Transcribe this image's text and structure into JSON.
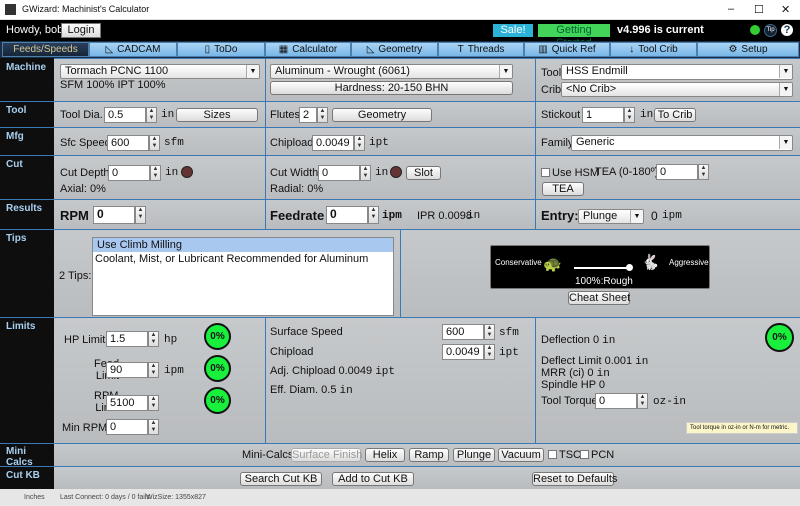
{
  "window": {
    "title": "GWizard: Machinist's Calculator",
    "minimize": "–",
    "maximize": "☐",
    "close": "✕"
  },
  "topbar": {
    "greeting": "Howdy, bob!",
    "login": "Login",
    "sale": "Sale!",
    "getting_started": "Getting Started",
    "version": "v4.996 is current",
    "tip": "Tip",
    "help": "?"
  },
  "tabs": [
    {
      "label": "Feeds/Speeds",
      "icon": ""
    },
    {
      "label": "CADCAM",
      "icon": "◺"
    },
    {
      "label": "ToDo",
      "icon": "▯"
    },
    {
      "label": "Calculator",
      "icon": "▦"
    },
    {
      "label": "Geometry",
      "icon": "◺"
    },
    {
      "label": "Threads",
      "icon": "T"
    },
    {
      "label": "Quick Ref",
      "icon": "▥"
    },
    {
      "label": "Tool Crib",
      "icon": "↓"
    },
    {
      "label": "Setup",
      "icon": "⚙"
    }
  ],
  "sections": {
    "machine": "Machine",
    "tool": "Tool",
    "mfg": "Mfg",
    "cut": "Cut",
    "results": "Results",
    "tips": "Tips",
    "limits": "Limits",
    "mini_calcs": "Mini Calcs",
    "cut_kb": "Cut KB"
  },
  "machine": {
    "machine": "Tormach PCNC 1100",
    "sfm_ipt": "SFM 100% IPT 100%",
    "material": "Aluminum - Wrought (6061)",
    "hardness": "Hardness: 20-150 BHN",
    "tool_label": "Tool",
    "tool": "HSS Endmill",
    "crib_label": "Crib",
    "crib": "<No Crib>"
  },
  "tool": {
    "dia_label": "Tool Dia.",
    "dia": "0.5",
    "dia_unit": "in",
    "sizes": "Sizes",
    "flutes_label": "Flutes",
    "flutes": "2",
    "geometry": "Geometry",
    "stickout_label": "Stickout",
    "stickout": "1",
    "stickout_unit": "in",
    "to_crib": "To Crib"
  },
  "mfg": {
    "sfc_label": "Sfc Speed",
    "sfc": "600",
    "sfc_unit": "sfm",
    "chip_label": "Chipload",
    "chip": "0.0049",
    "chip_unit": "ipt",
    "family_label": "Family:",
    "family": "Generic"
  },
  "cut": {
    "depth_label": "Cut Depth",
    "depth": "0",
    "depth_unit": "in",
    "axial": "Axial: 0%",
    "width_label": "Cut Width",
    "width": "0",
    "width_unit": "in",
    "slot": "Slot",
    "radial": "Radial: 0%",
    "hsm": "Use HSM",
    "tea_label": "TEA (0-180º)",
    "tea": "0",
    "tea_btn": "TEA"
  },
  "results": {
    "rpm_label": "RPM",
    "rpm": "0",
    "feed_label": "Feedrate",
    "feed": "0",
    "feed_unit": "ipm",
    "ipr": "IPR 0.0098",
    "ipr_unit": "in",
    "entry_label": "Entry:",
    "entry": "Plunge",
    "entry_val": "0",
    "entry_unit": "ipm"
  },
  "tips": {
    "count": "2 Tips:",
    "items": [
      "Use Climb Milling",
      "Coolant, Mist, or Lubricant Recommended for Aluminum"
    ],
    "conservative": "Conservative",
    "aggressive": "Aggressive",
    "slider_text": "100%:Rough",
    "slider_value": 1.0,
    "cheat": "Cheat Sheet"
  },
  "limits": {
    "hp_label": "HP Limit",
    "hp": "1.5",
    "hp_unit": "hp",
    "hp_pct": "0%",
    "feed_label1": "Feed",
    "feed_label2": "Limit",
    "feed": "90",
    "feed_unit": "ipm",
    "feed_pct": "0%",
    "rpm_label1": "RPM",
    "rpm_label2": "Limit",
    "rpm": "5100",
    "rpm_pct": "0%",
    "minrpm_label": "Min RPM",
    "minrpm": "0",
    "surf_label": "Surface Speed",
    "surf": "600",
    "surf_unit": "sfm",
    "chip_label": "Chipload",
    "chip": "0.0049",
    "chip_unit": "ipt",
    "adj": "Adj. Chipload 0.0049",
    "adj_unit": "ipt",
    "eff": "Eff. Diam. 0.5",
    "eff_unit": "in",
    "defl": "Deflection 0",
    "defl_unit": "in",
    "defl_pct": "0%",
    "defl_limit": "Deflect Limit 0.001",
    "defl_limit_unit": "in",
    "mrr": "MRR (ci) 0",
    "mrr_unit": "in",
    "spindle": "Spindle HP 0",
    "torque_label": "Tool Torque",
    "torque": "0",
    "torque_unit": "oz-in",
    "tooltip": "Tool torque in oz-in or N-m for metric."
  },
  "mini": {
    "label": "Mini-Calcs",
    "surface": "Surface Finish",
    "helix": "Helix",
    "ramp": "Ramp",
    "plunge": "Plunge",
    "vacuum": "Vacuum",
    "tsc": "TSC",
    "pcn": "PCN"
  },
  "cutkb": {
    "search": "Search Cut KB",
    "add": "Add to Cut KB",
    "reset": "Reset to Defaults"
  },
  "status": {
    "units": "Inches",
    "last": "Last Connect: 0 days / 0 fails",
    "size": "WizSize: 1355x827"
  }
}
